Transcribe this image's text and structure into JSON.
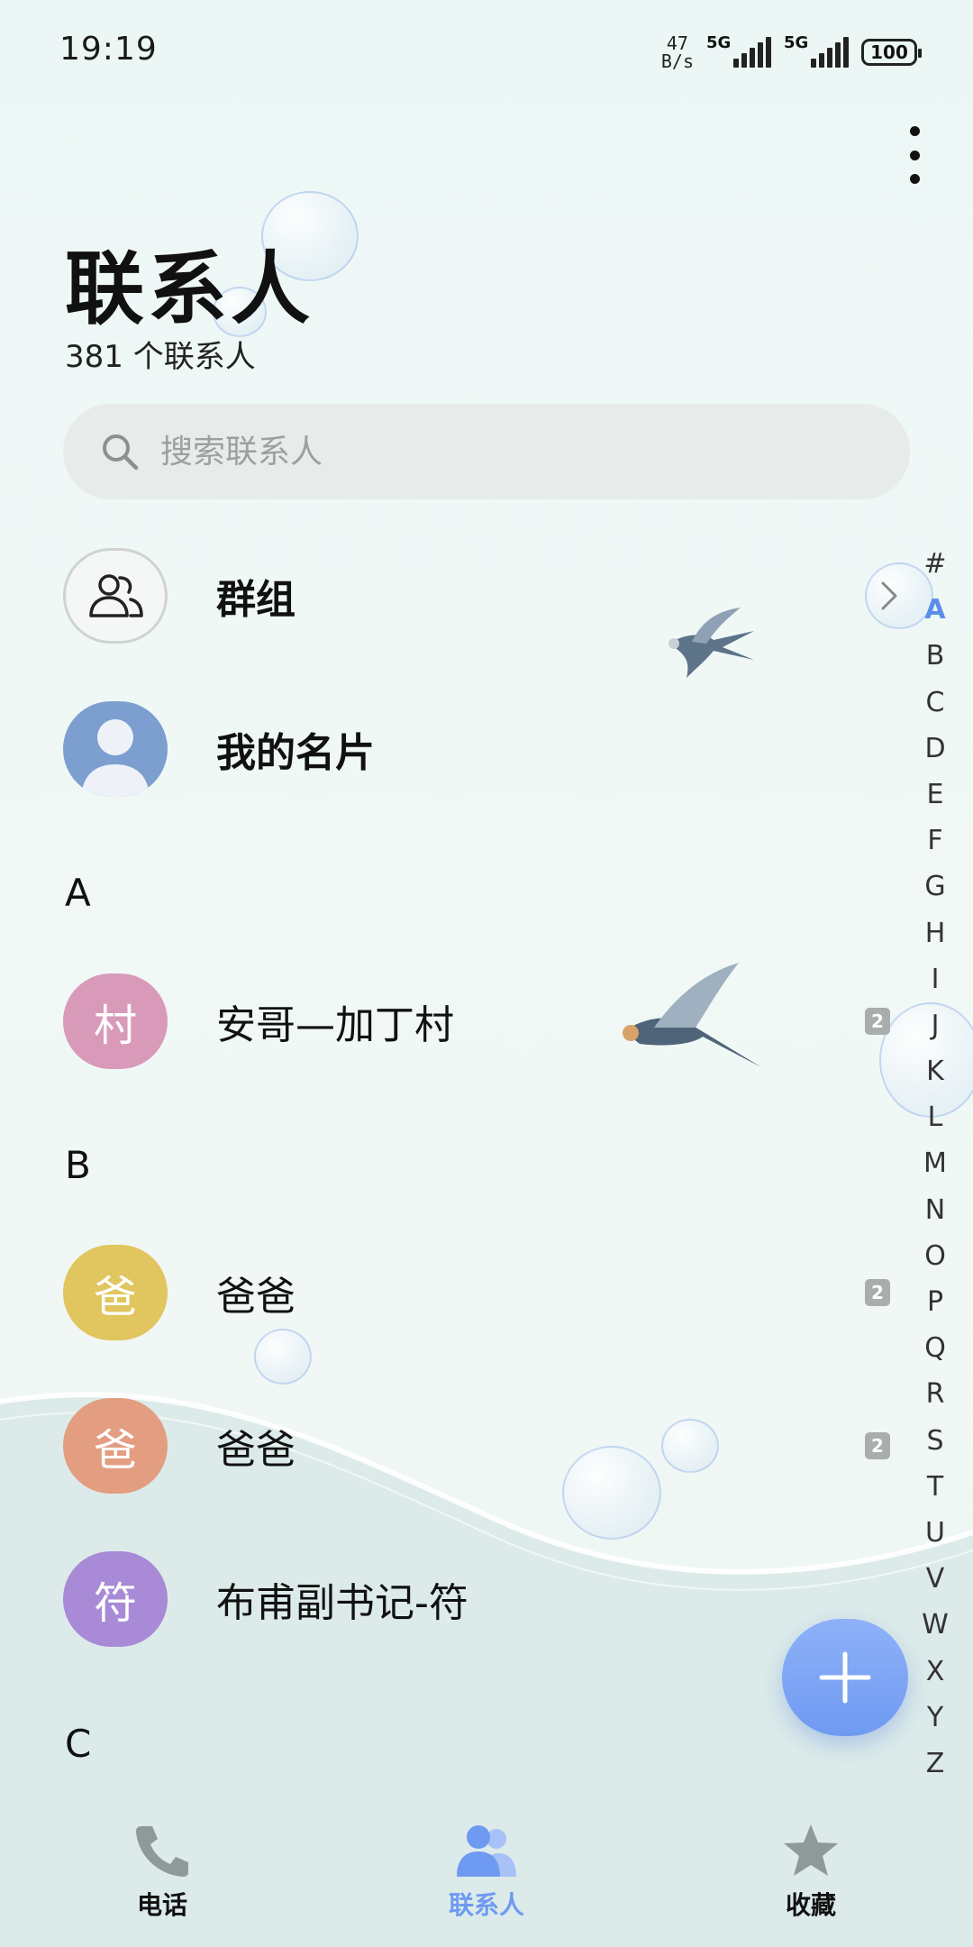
{
  "status_bar": {
    "time": "19:19",
    "net_speed_value": "47",
    "net_speed_unit": "B/s",
    "sim1_label": "5G",
    "sim2_label": "5G",
    "battery": "100"
  },
  "header": {
    "title": "联系人",
    "subtitle": "381 个联系人",
    "more_icon": "more-vertical-icon"
  },
  "search": {
    "placeholder": "搜索联系人",
    "value": ""
  },
  "top_items": [
    {
      "label": "群组",
      "icon": "group-icon"
    },
    {
      "label": "我的名片",
      "icon": "person-icon"
    }
  ],
  "sections": [
    {
      "letter": "A",
      "contacts": [
        {
          "avatar_text": "村",
          "name": "安哥—加丁村",
          "sim": "2",
          "color": "#d99ab9"
        }
      ]
    },
    {
      "letter": "B",
      "contacts": [
        {
          "avatar_text": "爸",
          "name": "爸爸",
          "sim": "2",
          "color": "#e1c55e"
        },
        {
          "avatar_text": "爸",
          "name": "爸爸",
          "sim": "2",
          "color": "#e39d81"
        },
        {
          "avatar_text": "符",
          "name": "布甫副书记-符",
          "sim": "",
          "color": "#a98ad6"
        }
      ]
    },
    {
      "letter": "C",
      "contacts": []
    }
  ],
  "alphabet_index": {
    "letters": [
      "#",
      "A",
      "B",
      "C",
      "D",
      "E",
      "F",
      "G",
      "H",
      "I",
      "J",
      "K",
      "L",
      "M",
      "N",
      "O",
      "P",
      "Q",
      "R",
      "S",
      "T",
      "U",
      "V",
      "W",
      "X",
      "Y",
      "Z"
    ],
    "active": "A"
  },
  "fab": {
    "icon": "plus-icon"
  },
  "bottom_nav": [
    {
      "label": "电话",
      "icon": "phone-icon",
      "active": false
    },
    {
      "label": "联系人",
      "icon": "contacts-icon",
      "active": true
    },
    {
      "label": "收藏",
      "icon": "star-icon",
      "active": false
    }
  ],
  "colors": {
    "accent": "#6f9af2",
    "background": "#eef7f5",
    "search_bg": "#e7ecea"
  }
}
